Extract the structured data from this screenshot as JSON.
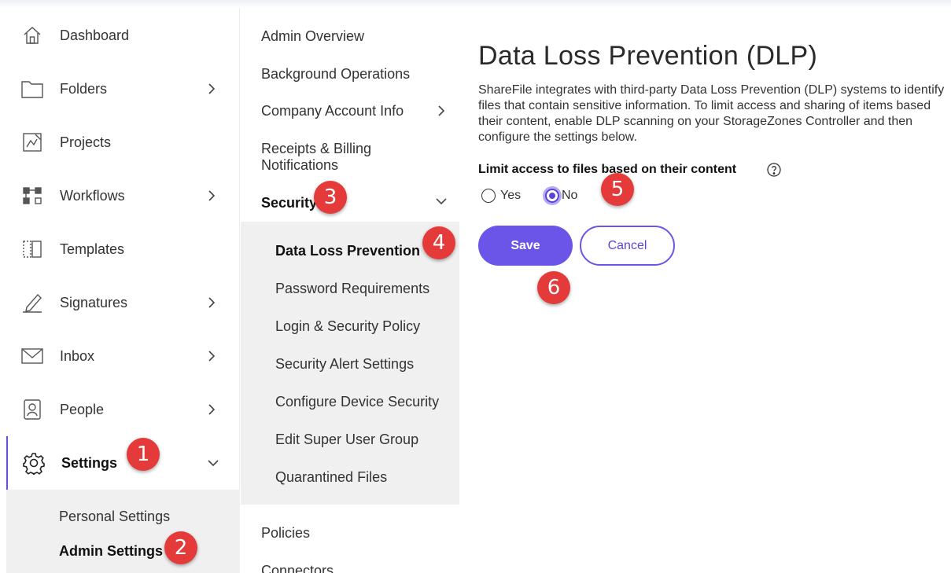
{
  "sidebar": {
    "items": [
      {
        "label": "Dashboard",
        "icon": "home-icon",
        "has_chevron": false
      },
      {
        "label": "Folders",
        "icon": "folder-icon",
        "has_chevron": true
      },
      {
        "label": "Projects",
        "icon": "projects-icon",
        "has_chevron": false
      },
      {
        "label": "Workflows",
        "icon": "workflows-icon",
        "has_chevron": true
      },
      {
        "label": "Templates",
        "icon": "templates-icon",
        "has_chevron": false
      },
      {
        "label": "Signatures",
        "icon": "signature-icon",
        "has_chevron": true
      },
      {
        "label": "Inbox",
        "icon": "mail-icon",
        "has_chevron": true
      },
      {
        "label": "People",
        "icon": "people-icon",
        "has_chevron": true
      },
      {
        "label": "Settings",
        "icon": "gear-icon",
        "has_chevron": true,
        "expanded": true,
        "active": true
      }
    ],
    "settings_sub": [
      {
        "label": "Personal Settings"
      },
      {
        "label": "Admin Settings",
        "active": true
      }
    ]
  },
  "admin_menu": {
    "items": [
      {
        "label": "Admin Overview"
      },
      {
        "label": "Background Operations"
      },
      {
        "label": "Company Account Info",
        "has_chevron": true
      },
      {
        "label": "Receipts & Billing Notifications"
      },
      {
        "label": "Security",
        "has_chevron": true,
        "expanded": true
      }
    ],
    "security_sub": [
      {
        "label": "Data Loss Prevention",
        "active": true
      },
      {
        "label": "Password Requirements"
      },
      {
        "label": "Login & Security Policy"
      },
      {
        "label": "Security Alert Settings"
      },
      {
        "label": "Configure Device Security"
      },
      {
        "label": "Edit Super User Group"
      },
      {
        "label": "Quarantined Files"
      }
    ],
    "after": [
      {
        "label": "Policies"
      },
      {
        "label": "Connectors"
      }
    ]
  },
  "main": {
    "title": "Data Loss Prevention (DLP)",
    "description": "ShareFile integrates with third-party Data Loss Prevention (DLP) systems to identify files that contain sensitive information. To limit access and sharing of items based their content, enable DLP scanning on your StorageZones Controller and then configure the settings below.",
    "limit_label": "Limit access to files based on their content",
    "options": [
      {
        "label": "Yes",
        "selected": false
      },
      {
        "label": "No",
        "selected": true
      }
    ],
    "save_label": "Save",
    "cancel_label": "Cancel"
  },
  "callouts": [
    "1",
    "2",
    "3",
    "4",
    "5",
    "6"
  ],
  "colors": {
    "accent": "#6a55e8",
    "callout": "#e53a3a",
    "submenu_bg": "#f0f0f0"
  }
}
